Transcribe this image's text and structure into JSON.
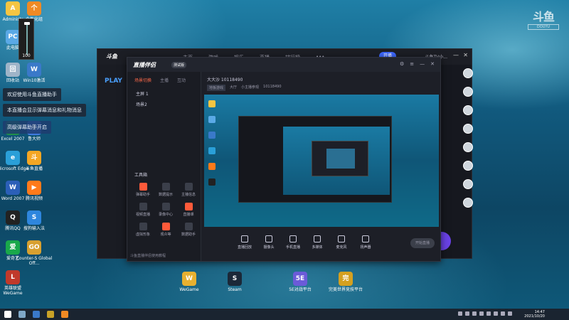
{
  "desktop": {
    "icons": [
      {
        "label": "Administr",
        "color": "#f5c542",
        "glyph": "A"
      },
      {
        "label": "个性化组",
        "color": "#f08a24",
        "glyph": "个"
      },
      {
        "label": "此电脑",
        "color": "#5aa9e6",
        "glyph": "PC"
      },
      {
        "label": "回收站",
        "color": "#9fb4c8",
        "glyph": "回"
      },
      {
        "label": "Win10激活",
        "color": "#3a79c9",
        "glyph": "W"
      },
      {
        "label": "Excel 2007",
        "color": "#1f8f4a",
        "glyph": "X"
      },
      {
        "label": "鲁大师",
        "color": "#3f7be0",
        "glyph": "鲁"
      },
      {
        "label": "Microsoft Edge",
        "color": "#2a9fd8",
        "glyph": "e"
      },
      {
        "label": "斗鱼直播",
        "color": "#f5a623",
        "glyph": "斗"
      },
      {
        "label": "Word 2007",
        "color": "#2b5fb8",
        "glyph": "W"
      },
      {
        "label": "腾讯视频",
        "color": "#ff7a1a",
        "glyph": "▶"
      },
      {
        "label": "腾讯QQ",
        "color": "#222",
        "glyph": "Q"
      },
      {
        "label": "搜狗输入法",
        "color": "#2e86de",
        "glyph": "S"
      },
      {
        "label": "爱奇艺",
        "color": "#19a84a",
        "glyph": "爱"
      },
      {
        "label": "Counter-S Global Off...",
        "color": "#d8a030",
        "glyph": "GO"
      },
      {
        "label": "英雄联盟 WeGame",
        "color": "#c0392b",
        "glyph": "L"
      }
    ],
    "bottom_icons": [
      {
        "label": "WeGame",
        "color": "#e8b030",
        "glyph": "W"
      },
      {
        "label": "Steam",
        "color": "#1b2838",
        "glyph": "S"
      },
      {
        "label": "5E对战平台",
        "color": "#6b5bd8",
        "glyph": "5E"
      },
      {
        "label": "完美世界竞技平台",
        "color": "#d4a020",
        "glyph": "完"
      }
    ],
    "volume": "100"
  },
  "toasts": {
    "welcome": "欢迎使用斗鱼直播助手",
    "room_msg": "本直播会显示弹幕消息和礼物消息",
    "tip": "高级弹幕助手开启"
  },
  "app": {
    "logo": "斗鱼",
    "play_label": "PLAY",
    "nav": [
      "主页",
      "游戏",
      "娱乐",
      "直播",
      "排行榜",
      "•••"
    ],
    "live_button": "开播",
    "username": "斗鱼TV小..."
  },
  "broadcaster": {
    "brand": "直播伴侣",
    "badge": "测试版",
    "tabs": [
      "场景切换",
      "主播",
      "互动"
    ],
    "scenes": [
      "主屏 1",
      "场景2"
    ],
    "room_title": "大大沙  10118490",
    "room_tags": [
      "地板游戏",
      "大厅",
      "小主播参观",
      "10118490"
    ],
    "tools_header": "工具箱",
    "tools": [
      {
        "label": "弹幕助手",
        "red": true
      },
      {
        "label": "数据提示",
        "red": false
      },
      {
        "label": "主播信息",
        "red": false
      },
      {
        "label": "视频直播",
        "red": false
      },
      {
        "label": "录像中心",
        "red": false
      },
      {
        "label": "直播课",
        "red": true
      },
      {
        "label": "虚拟形象",
        "red": false
      },
      {
        "label": "观众等",
        "red": true
      },
      {
        "label": "数据助手",
        "red": false
      }
    ],
    "notice": "斗鱼直播伴侣使用教程",
    "bottom_buttons": [
      "直播回放",
      "摄像头",
      "手机直播",
      "多媒体",
      "麦克风",
      "扬声器"
    ],
    "start_button": "开始直播"
  },
  "taskbar": {
    "time": "14:47",
    "date": "2021/10/20"
  },
  "watermark": {
    "big": "斗鱼",
    "small": "DOUYU"
  }
}
